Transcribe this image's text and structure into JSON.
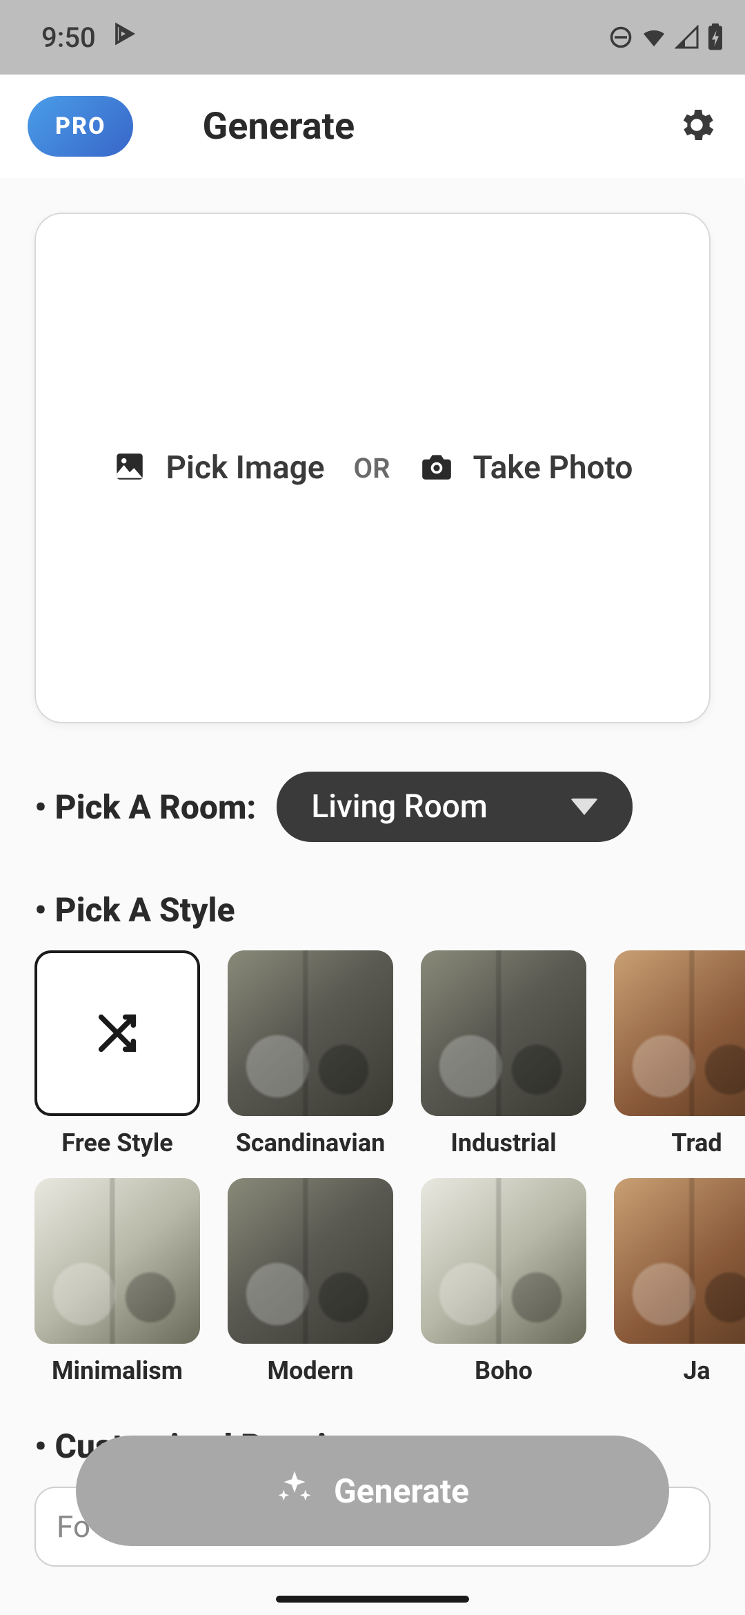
{
  "status": {
    "time": "9:50"
  },
  "header": {
    "pro_badge": "PRO",
    "title": "Generate"
  },
  "upload": {
    "pick_image": "Pick Image",
    "or": "OR",
    "take_photo": "Take Photo"
  },
  "room": {
    "label": "Pick A Room:",
    "selected": "Living Room"
  },
  "style": {
    "label": "Pick A Style",
    "row1": [
      {
        "name": "Free Style",
        "kind": "free"
      },
      {
        "name": "Scandinavian",
        "kind": "thumb"
      },
      {
        "name": "Industrial",
        "kind": "thumb"
      },
      {
        "name": "Trad",
        "kind": "warm"
      }
    ],
    "row2": [
      {
        "name": "Minimalism",
        "kind": "light"
      },
      {
        "name": "Modern",
        "kind": "thumb"
      },
      {
        "name": "Boho",
        "kind": "light"
      },
      {
        "name": "Ja",
        "kind": "warm"
      }
    ]
  },
  "customized": {
    "label": "Customized Requirements",
    "placeholder_visible": "Fo"
  },
  "cta": {
    "label": "Generate"
  },
  "colors": {
    "pro_gradient_start": "#4a9de8",
    "pro_gradient_end": "#3866c9",
    "pill_bg": "#3a3a3a",
    "cta_bg": "#a8a8a8"
  }
}
